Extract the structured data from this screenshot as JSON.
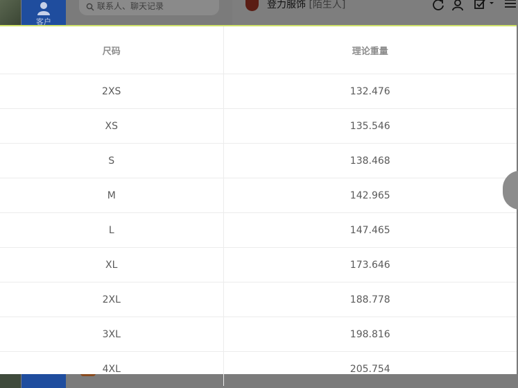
{
  "background": {
    "contact_tab_label": "客户",
    "search": {
      "placeholder": "联系人、聊天记录"
    },
    "chat": {
      "name": "登力服饰",
      "tag": "[陌生人]"
    }
  },
  "size_table": {
    "headers": [
      "尺码",
      "理论重量"
    ],
    "rows": [
      [
        "2XS",
        "132.476"
      ],
      [
        "XS",
        "135.546"
      ],
      [
        "S",
        "138.468"
      ],
      [
        "M",
        "142.965"
      ],
      [
        "L",
        "147.465"
      ],
      [
        "XL",
        "173.646"
      ],
      [
        "2XL",
        "188.778"
      ],
      [
        "3XL",
        "198.816"
      ],
      [
        "4XL",
        "205.754"
      ]
    ]
  }
}
